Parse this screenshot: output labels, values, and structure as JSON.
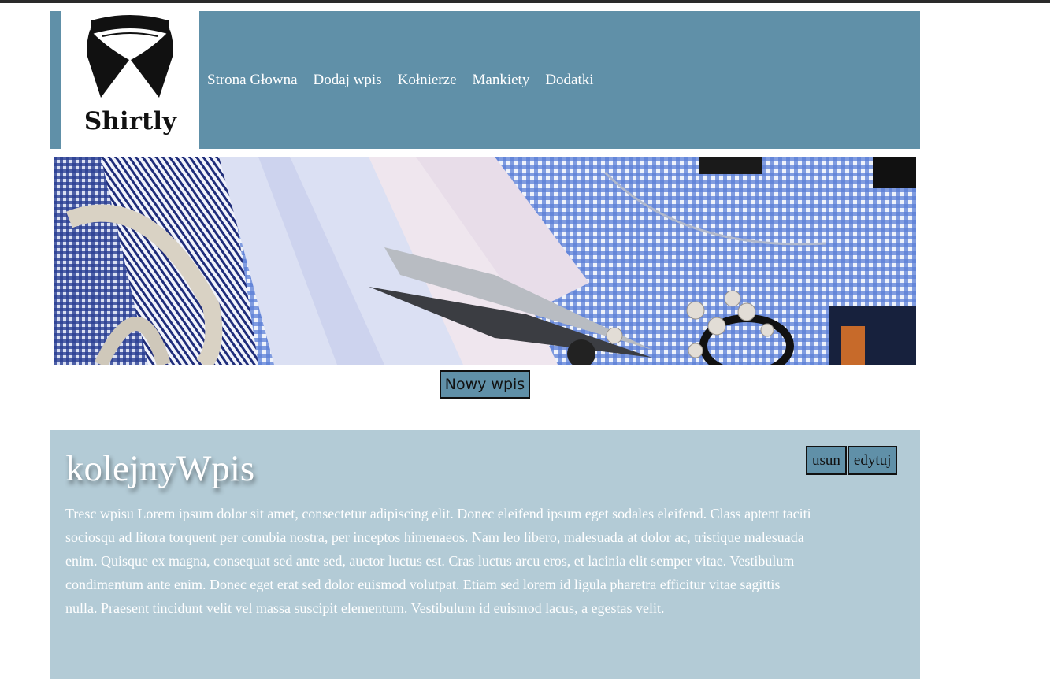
{
  "brand": {
    "name": "Shirtly"
  },
  "nav": {
    "items": [
      {
        "label": "Strona Głowna"
      },
      {
        "label": "Dodaj wpis"
      },
      {
        "label": "Kołnierze"
      },
      {
        "label": "Mankiety"
      },
      {
        "label": "Dodatki"
      }
    ]
  },
  "actions": {
    "new_post_label": "Nowy wpis"
  },
  "post": {
    "title": "kolejnyWpis",
    "body": "Tresc wpisu Lorem ipsum dolor sit amet, consectetur adipiscing elit. Donec eleifend ipsum eget sodales eleifend. Class aptent taciti sociosqu ad litora torquent per conubia nostra, per inceptos himenaeos. Nam leo libero, malesuada at dolor ac, tristique malesuada enim. Quisque ex magna, consequat sed ante sed, auctor luctus est. Cras luctus arcu eros, et lacinia elit semper vitae. Vestibulum condimentum ante enim. Donec eget erat sed dolor euismod volutpat. Etiam sed lorem id ligula pharetra efficitur vitae sagittis nulla. Praesent tincidunt velit vel massa suscipit elementum. Vestibulum id euismod lacus, a egestas velit.",
    "delete_label": "usun",
    "edit_label": "edytuj"
  },
  "colors": {
    "header_bg": "#6090a8",
    "post_bg": "#b3cbd6",
    "button_bg": "#6090a8"
  },
  "icons": {
    "logo": "shirt-collar-icon"
  }
}
